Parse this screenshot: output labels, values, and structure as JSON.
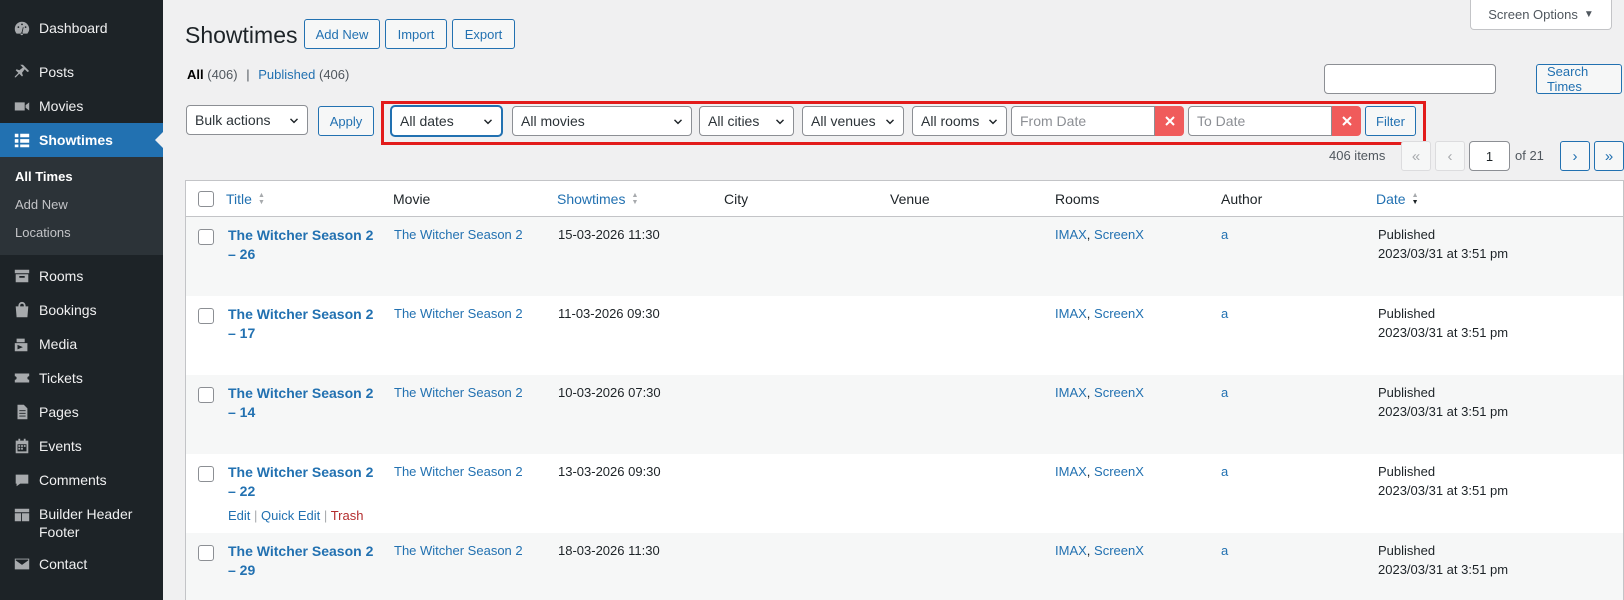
{
  "sidebar": {
    "items": [
      {
        "label": "Dashboard",
        "icon": "dashboard-icon"
      },
      {
        "label": "Posts",
        "icon": "pin-icon"
      },
      {
        "label": "Movies",
        "icon": "video-icon"
      },
      {
        "label": "Showtimes",
        "icon": "grid-icon"
      },
      {
        "label": "Rooms",
        "icon": "archive-icon"
      },
      {
        "label": "Bookings",
        "icon": "bag-icon"
      },
      {
        "label": "Media",
        "icon": "media-icon"
      },
      {
        "label": "Tickets",
        "icon": "ticket-icon"
      },
      {
        "label": "Pages",
        "icon": "page-icon"
      },
      {
        "label": "Events",
        "icon": "calendar-icon"
      },
      {
        "label": "Comments",
        "icon": "comment-icon"
      },
      {
        "label": "Builder Header Footer",
        "icon": "layout-icon"
      },
      {
        "label": "Contact",
        "icon": "email-icon"
      }
    ],
    "submenu": [
      "All Times",
      "Add New",
      "Locations"
    ]
  },
  "header": {
    "title": "Showtimes",
    "add_new": "Add New",
    "import": "Import",
    "export": "Export",
    "screen_options": "Screen Options"
  },
  "views": {
    "all_label": "All",
    "all_count": "(406)",
    "separator": "|",
    "published_label": "Published",
    "published_count": "(406)"
  },
  "search": {
    "button": "Search Times",
    "value": ""
  },
  "filters": {
    "bulk_actions": "Bulk actions",
    "apply": "Apply",
    "dates": "All dates",
    "movies": "All movies",
    "cities": "All cities",
    "venues": "All venues",
    "rooms": "All rooms",
    "from_date_placeholder": "From Date",
    "to_date_placeholder": "To Date",
    "filter": "Filter",
    "highlight_color": "#e21b1b"
  },
  "pagination": {
    "items": "406 items",
    "first": "«",
    "prev": "‹",
    "current": "1",
    "of": "of 21",
    "next": "›",
    "last": "»"
  },
  "table": {
    "columns": {
      "title": "Title",
      "movie": "Movie",
      "showtimes": "Showtimes",
      "city": "City",
      "venue": "Venue",
      "rooms": "Rooms",
      "author": "Author",
      "date": "Date"
    },
    "rows": [
      {
        "title1": "The Witcher Season 2",
        "title2": "– 26",
        "movie": "The Witcher Season 2",
        "showtime": "15-03-2026 11:30",
        "room1": "IMAX",
        "room2": "ScreenX",
        "author": "a",
        "status": "Published",
        "date": "2023/03/31 at 3:51 pm"
      },
      {
        "title1": "The Witcher Season 2",
        "title2": "– 17",
        "movie": "The Witcher Season 2",
        "showtime": "11-03-2026 09:30",
        "room1": "IMAX",
        "room2": "ScreenX",
        "author": "a",
        "status": "Published",
        "date": "2023/03/31 at 3:51 pm"
      },
      {
        "title1": "The Witcher Season 2",
        "title2": "– 14",
        "movie": "The Witcher Season 2",
        "showtime": "10-03-2026 07:30",
        "room1": "IMAX",
        "room2": "ScreenX",
        "author": "a",
        "status": "Published",
        "date": "2023/03/31 at 3:51 pm"
      },
      {
        "title1": "The Witcher Season 2",
        "title2": "– 22",
        "movie": "The Witcher Season 2",
        "showtime": "13-03-2026 09:30",
        "room1": "IMAX",
        "room2": "ScreenX",
        "author": "a",
        "status": "Published",
        "date": "2023/03/31 at 3:51 pm"
      },
      {
        "title1": "The Witcher Season 2",
        "title2": "– 29",
        "movie": "The Witcher Season 2",
        "showtime": "18-03-2026 11:30",
        "room1": "IMAX",
        "room2": "ScreenX",
        "author": "a",
        "status": "Published",
        "date": "2023/03/31 at 3:51 pm"
      }
    ],
    "row_actions": {
      "edit": "Edit",
      "quick_edit": "Quick Edit",
      "trash": "Trash",
      "sep": "|"
    },
    "room_sep": ","
  }
}
